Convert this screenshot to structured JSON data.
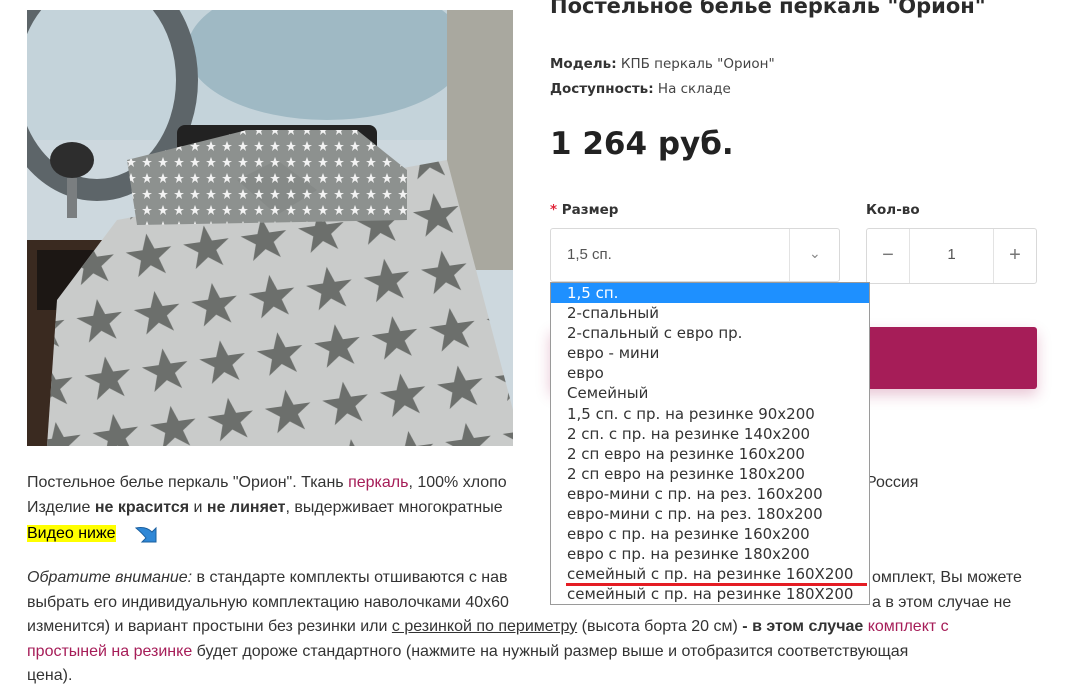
{
  "product": {
    "title": "Постельное белье перкаль \"Орион\"",
    "model_label": "Модель:",
    "model_value": "КПБ перкаль \"Орион\"",
    "availability_label": "Доступность:",
    "availability_value": "На складе",
    "price": "1 264 руб."
  },
  "options": {
    "required_mark": "*",
    "size_label": "Размер",
    "qty_label": "Кол-во",
    "size_selected": "1,5 сп.",
    "qty_value": "1",
    "qty_minus": "−",
    "qty_plus": "+",
    "size_list": [
      "1,5 сп.",
      "2-спальный",
      "2-спальный с евро пр.",
      "евро - мини",
      "евро",
      "Семейный",
      "1,5 сп. с пр. на резинке 90х200",
      "2 сп. с пр. на резинке 140х200",
      "2 сп евро на резинке 160х200",
      "2 сп евро на резинке 180х200",
      "евро-мини с пр. на рез. 160х200",
      "евро-мини с пр. на рез. 180х200",
      "евро с пр. на резинке 160х200",
      "евро с пр. на резинке 180х200",
      "семейный с пр. на резинке 160Х200",
      "семейный с пр. на резинке 180Х200"
    ]
  },
  "description": {
    "line1_a": "Постельное белье перкаль \"Орион\". Ткань ",
    "line1_link": "перкаль",
    "line1_b": ", 100% хлопо",
    "line1_right": "Россия",
    "line2_a": "Изделие ",
    "line2_b1": "не красится",
    "line2_c": " и ",
    "line2_b2": "не линяет",
    "line2_d": ", выдерживает многократные",
    "video_label": "Видео ниже",
    "note_italic": "Обратите внимание:",
    "note_1": " в стандарте комплекты отшиваются с нав",
    "note_1r": "омплект, Вы можете",
    "note_2": "выбрать его индивидуальную комплектацию наволочками 40х60",
    "note_2r": "а в этом случае не",
    "note_3a": "изменится) и вариант простыни без резинки или ",
    "note_3u": "с резинкой по периметру",
    "note_3b": " (высота борта 20 см)",
    "note_3c": " - в этом случае ",
    "note_3link": "комплект с",
    "note_4link": "простыней на резинке",
    "note_4": " будет дороже стандартного (нажмите на нужный размер выше и отобразится соответствующая",
    "note_5": "цена)."
  },
  "colors": {
    "accent": "#a61d58",
    "selected": "#1e90ff",
    "underline": "#e41c23"
  }
}
